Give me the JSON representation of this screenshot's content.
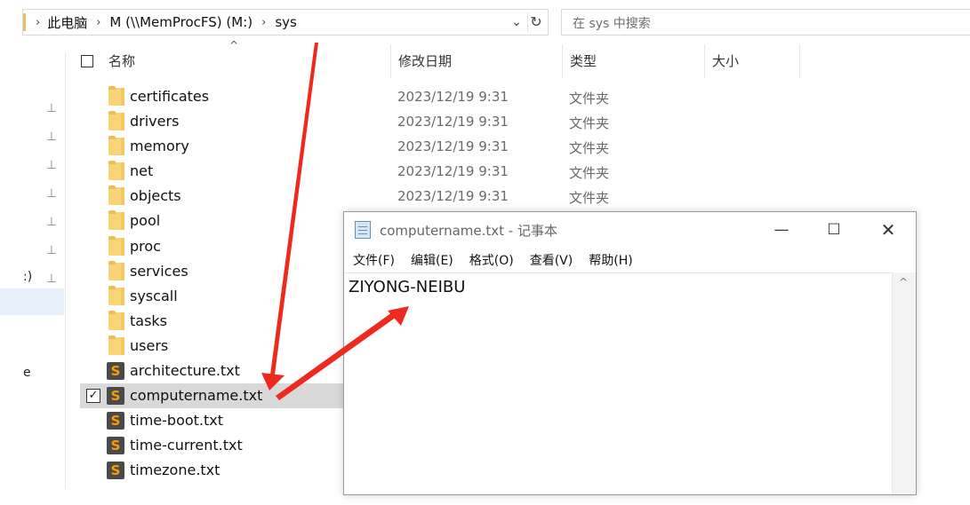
{
  "explorer": {
    "breadcrumbs": [
      "此电脑",
      "M (\\\\MemProcFS) (M:)",
      "sys"
    ],
    "search_placeholder": "在 sys 中搜索",
    "columns": {
      "name": "名称",
      "date": "修改日期",
      "type": "类型",
      "size": "大小"
    },
    "folder_type": "文件夹",
    "date": "2023/12/19 9:31",
    "items": [
      {
        "name": "certificates",
        "kind": "folder",
        "date": "2023/12/19 9:31",
        "type": "文件夹"
      },
      {
        "name": "drivers",
        "kind": "folder",
        "date": "2023/12/19 9:31",
        "type": "文件夹"
      },
      {
        "name": "memory",
        "kind": "folder",
        "date": "2023/12/19 9:31",
        "type": "文件夹"
      },
      {
        "name": "net",
        "kind": "folder",
        "date": "2023/12/19 9:31",
        "type": "文件夹"
      },
      {
        "name": "objects",
        "kind": "folder",
        "date": "2023/12/19 9:31",
        "type": "文件夹"
      },
      {
        "name": "pool",
        "kind": "folder"
      },
      {
        "name": "proc",
        "kind": "folder"
      },
      {
        "name": "services",
        "kind": "folder"
      },
      {
        "name": "syscall",
        "kind": "folder"
      },
      {
        "name": "tasks",
        "kind": "folder"
      },
      {
        "name": "users",
        "kind": "folder"
      },
      {
        "name": "architecture.txt",
        "kind": "text"
      },
      {
        "name": "computername.txt",
        "kind": "text",
        "selected": true
      },
      {
        "name": "time-boot.txt",
        "kind": "text"
      },
      {
        "name": "time-current.txt",
        "kind": "text"
      },
      {
        "name": "timezone.txt",
        "kind": "text"
      }
    ],
    "nav_fragments": [
      ":)",
      "e"
    ],
    "icons": {
      "text_file_glyph": "S",
      "pin": "📌"
    }
  },
  "notepad": {
    "title": "computername.txt - 记事本",
    "menu": [
      "文件(F)",
      "编辑(E)",
      "格式(O)",
      "查看(V)",
      "帮助(H)"
    ],
    "content": "ZIYONG-NEIBU"
  },
  "colors": {
    "annotation_arrow": "#ee2a1f",
    "selected_row": "#d9d9d9",
    "folder": "#f9d476"
  }
}
